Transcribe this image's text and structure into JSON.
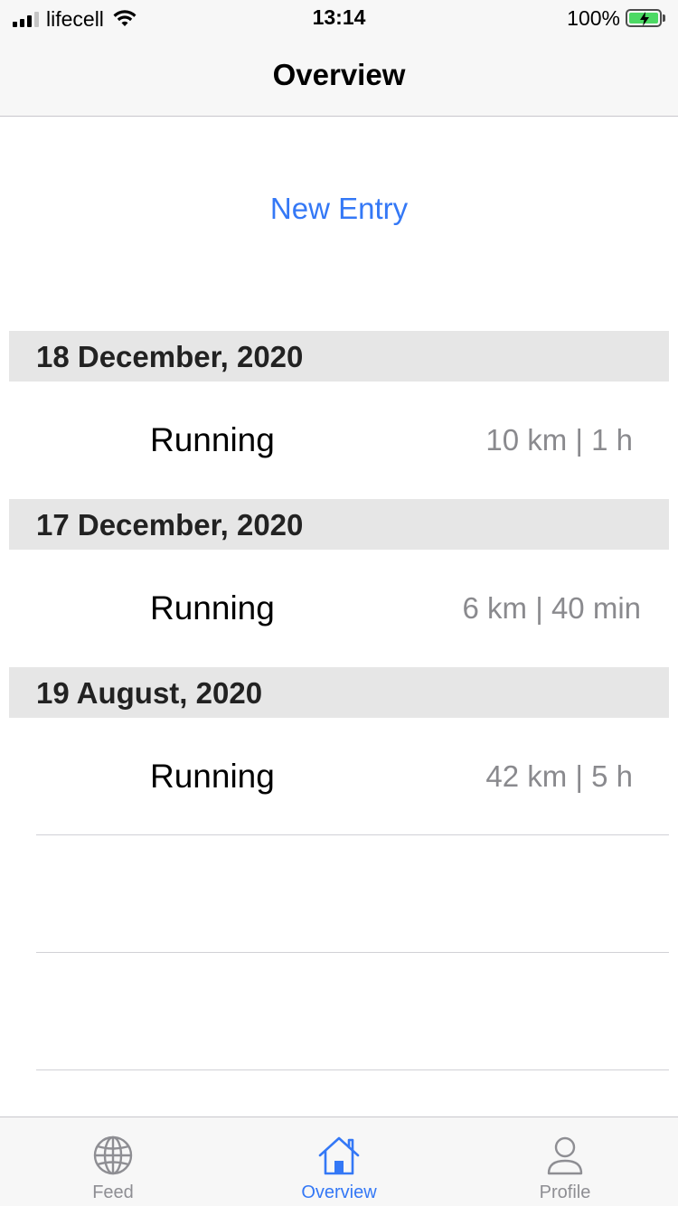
{
  "status_bar": {
    "carrier": "lifecell",
    "time": "13:14",
    "battery_percent": "100%",
    "battery_level": 1.0,
    "charging": true
  },
  "nav": {
    "title": "Overview"
  },
  "actions": {
    "new_entry_label": "New Entry"
  },
  "sections": [
    {
      "date": "18 December, 2020",
      "entries": [
        {
          "activity": "Running",
          "stats": "10 km | 1 h"
        }
      ]
    },
    {
      "date": "17 December, 2020",
      "entries": [
        {
          "activity": "Running",
          "stats": "6 km | 40 min"
        }
      ]
    },
    {
      "date": "19 August, 2020",
      "entries": [
        {
          "activity": "Running",
          "stats": "42 km | 5 h"
        }
      ]
    }
  ],
  "tab_bar": {
    "selected": "Overview",
    "tabs": [
      {
        "label": "Feed",
        "icon": "globe-icon"
      },
      {
        "label": "Overview",
        "icon": "house-icon"
      },
      {
        "label": "Profile",
        "icon": "person-icon"
      }
    ]
  },
  "colors": {
    "accent": "#3478f6",
    "section_bg": "#e6e6e6",
    "secondary_text": "#8a8a8e",
    "battery_green": "#4cd964"
  }
}
